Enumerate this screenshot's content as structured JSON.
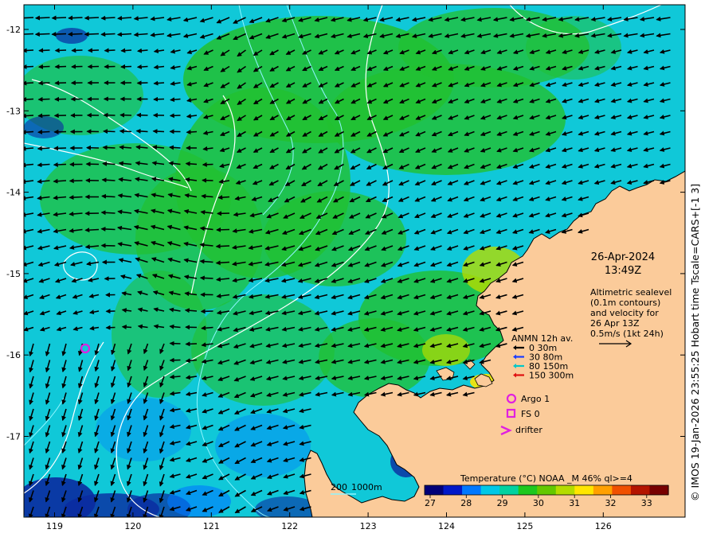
{
  "map": {
    "date": "26-Apr-2024",
    "time": "13:49Z",
    "altimetry_lines": [
      "Altimetric sealevel",
      "(0.1m contours)",
      "and velocity for",
      "26 Apr 13Z",
      "0.5m/s (1kt 24h)"
    ],
    "side_credit": "© IMOS 19-Jan-2026 23:55:25 Hobart time Tscale=CARS+[-1 3]",
    "bathy_label_a": "200",
    "bathy_label_b": "1000m",
    "colorbar_title": "Temperature (°C) NOAA _M 46% ql>=4",
    "colorbar_ticks": [
      "27",
      "28",
      "29",
      "30",
      "31",
      "32",
      "33"
    ],
    "colorbar_colors": [
      "#000078",
      "#0018c8",
      "#0078ff",
      "#00c8e6",
      "#00d2a0",
      "#1ec81e",
      "#64c800",
      "#b4dc00",
      "#ffe600",
      "#ffa000",
      "#f05000",
      "#b41400",
      "#780000"
    ],
    "x_ticks": [
      "119",
      "120",
      "121",
      "122",
      "123",
      "124",
      "125",
      "126"
    ],
    "y_ticks": [
      "-12",
      "-13",
      "-14",
      "-15",
      "-16",
      "-17"
    ],
    "legend": {
      "title": "ANMN 12h av.",
      "depths": [
        {
          "label": "0 30m",
          "color": "#000000"
        },
        {
          "label": "30 80m",
          "color": "#1a3cff"
        },
        {
          "label": "80 150m",
          "color": "#00c8c8"
        },
        {
          "label": "150 300m",
          "color": "#e01010"
        }
      ],
      "argo": "Argo 1",
      "fs": "FS 0",
      "drifter": "drifter",
      "marker_color": "#e020e0"
    },
    "colors": {
      "land": "#fbcb9a",
      "ocean_base": "#10c8d8",
      "warm": "#22c030",
      "cold": "#0a2aa0",
      "contour": "#ffffff"
    }
  }
}
